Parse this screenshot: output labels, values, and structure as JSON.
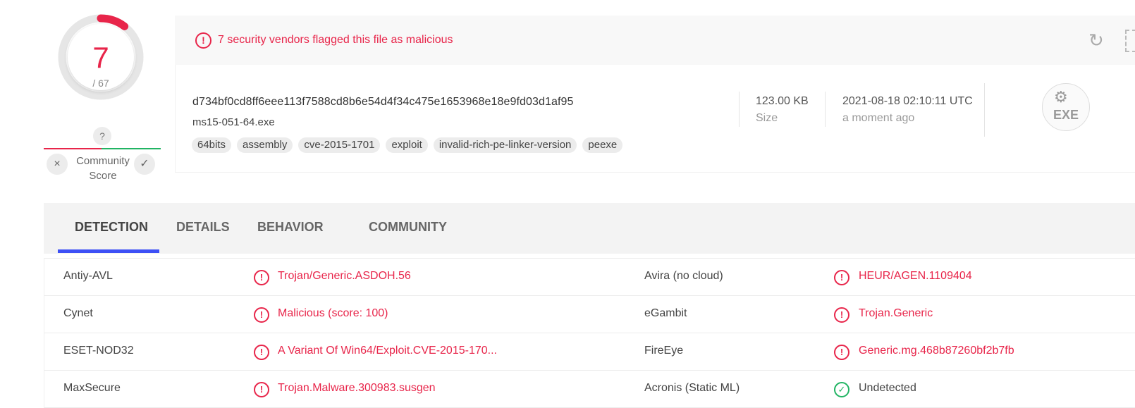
{
  "score": {
    "detected": "7",
    "total": "/ 67",
    "ratio": 0.1045,
    "color": "#e8254a"
  },
  "community": {
    "question": "?",
    "label": "Community Score",
    "dislike_icon": "×",
    "like_icon": "✓"
  },
  "alert": {
    "icon": "!",
    "text": "7 security vendors flagged this file as malicious",
    "reload_icon": "↻"
  },
  "file": {
    "hash": "d734bf0cd8ff6eee113f7588cd8b6e54d4f34c475e1653968e18e9fd03d1af95",
    "name": "ms15-051-64.exe",
    "tags": [
      "64bits",
      "assembly",
      "cve-2015-1701",
      "exploit",
      "invalid-rich-pe-linker-version",
      "peexe"
    ],
    "size_value": "123.00 KB",
    "size_label": "Size",
    "date_value": "2021-08-18 02:10:11 UTC",
    "date_relative": "a moment ago",
    "type_icon": "EXE",
    "gear_icon": "⚙"
  },
  "tabs": [
    {
      "label": "DETECTION",
      "active": true
    },
    {
      "label": "DETAILS",
      "active": false
    },
    {
      "label": "BEHAVIOR",
      "active": false
    },
    {
      "label": "COMMUNITY",
      "active": false
    }
  ],
  "detections": [
    {
      "left": {
        "engine": "Antiy-AVL",
        "result": "Trojan/Generic.ASDOH.56",
        "status": "malicious"
      },
      "right": {
        "engine": "Avira (no cloud)",
        "result": "HEUR/AGEN.1109404",
        "status": "malicious"
      }
    },
    {
      "left": {
        "engine": "Cynet",
        "result": "Malicious (score: 100)",
        "status": "malicious"
      },
      "right": {
        "engine": "eGambit",
        "result": "Trojan.Generic",
        "status": "malicious"
      }
    },
    {
      "left": {
        "engine": "ESET-NOD32",
        "result": "A Variant Of Win64/Exploit.CVE-2015-170...",
        "status": "malicious"
      },
      "right": {
        "engine": "FireEye",
        "result": "Generic.mg.468b87260bf2b7fb",
        "status": "malicious"
      }
    },
    {
      "left": {
        "engine": "MaxSecure",
        "result": "Trojan.Malware.300983.susgen",
        "status": "malicious"
      },
      "right": {
        "engine": "Acronis (Static ML)",
        "result": "Undetected",
        "status": "undetected"
      }
    }
  ],
  "colors": {
    "malicious": "#e8254a",
    "clean": "#21b463",
    "tab_accent": "#3d50f5"
  }
}
